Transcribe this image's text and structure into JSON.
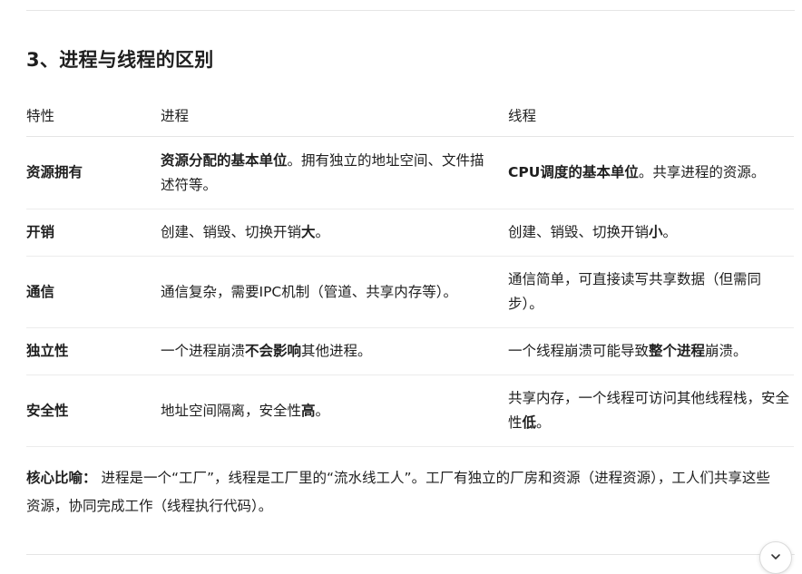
{
  "section": {
    "title": "3、进程与线程的区别"
  },
  "table": {
    "headers": [
      "特性",
      "进程",
      "线程"
    ],
    "rows": [
      {
        "feature": "资源拥有",
        "process": [
          {
            "t": "资源分配的基本单位",
            "b": true
          },
          {
            "t": "。拥有独立的地址空间、文件描述符等。",
            "b": false
          }
        ],
        "thread": [
          {
            "t": "CPU调度的基本单位",
            "b": true
          },
          {
            "t": "。共享进程的资源。",
            "b": false
          }
        ]
      },
      {
        "feature": "开销",
        "process": [
          {
            "t": "创建、销毁、切换开销",
            "b": false
          },
          {
            "t": "大",
            "b": true
          },
          {
            "t": "。",
            "b": false
          }
        ],
        "thread": [
          {
            "t": "创建、销毁、切换开销",
            "b": false
          },
          {
            "t": "小",
            "b": true
          },
          {
            "t": "。",
            "b": false
          }
        ]
      },
      {
        "feature": "通信",
        "process": [
          {
            "t": "通信复杂，需要IPC机制（管道、共享内存等）。",
            "b": false
          }
        ],
        "thread": [
          {
            "t": "通信简单，可直接读写共享数据（但需同步）。",
            "b": false
          }
        ]
      },
      {
        "feature": "独立性",
        "process": [
          {
            "t": "一个进程崩溃",
            "b": false
          },
          {
            "t": "不会影响",
            "b": true
          },
          {
            "t": "其他进程。",
            "b": false
          }
        ],
        "thread": [
          {
            "t": "一个线程崩溃可能导致",
            "b": false
          },
          {
            "t": "整个进程",
            "b": true
          },
          {
            "t": "崩溃。",
            "b": false
          }
        ]
      },
      {
        "feature": "安全性",
        "process": [
          {
            "t": "地址空间隔离，安全性",
            "b": false
          },
          {
            "t": "高",
            "b": true
          },
          {
            "t": "。",
            "b": false
          }
        ],
        "thread": [
          {
            "t": "共享内存，一个线程可访问其他线程栈，安全性",
            "b": false
          },
          {
            "t": "低",
            "b": true
          },
          {
            "t": "。",
            "b": false
          }
        ]
      }
    ]
  },
  "summary": {
    "label": "核心比喻：",
    "text": " 进程是一个“工厂”，线程是工厂里的“流水线工人”。工厂有独立的厂房和资源（进程资源），工人们共享这些资源，协同完成工作（线程执行代码）。"
  },
  "scroll_button": {
    "icon": "chevron-down-icon"
  }
}
